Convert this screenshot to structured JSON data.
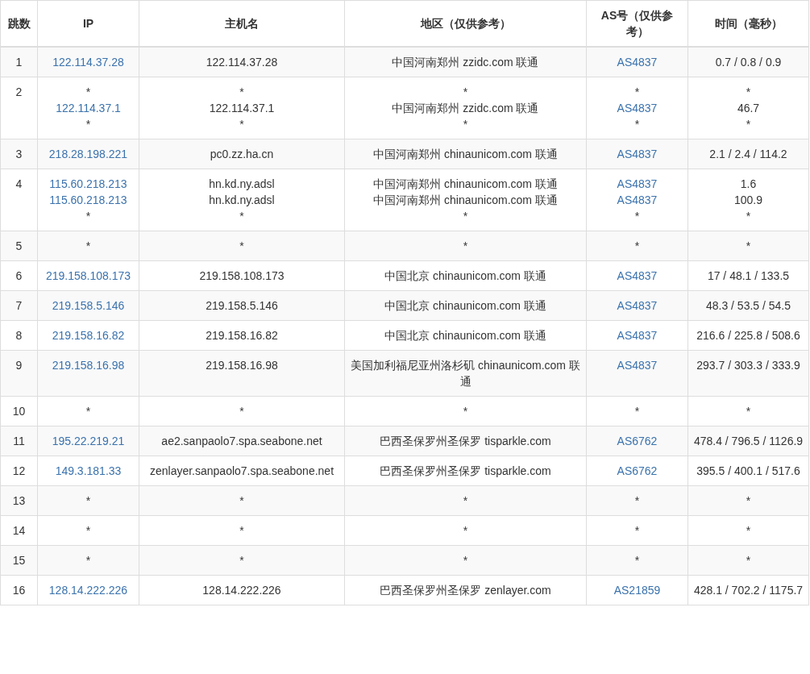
{
  "table": {
    "columns": [
      "跳数",
      "IP",
      "主机名",
      "地区（仅供参考）",
      "AS号（仅供参考）",
      "时间（毫秒）"
    ],
    "rows": [
      {
        "hop": "1",
        "ip": [
          {
            "text": "122.114.37.28",
            "kind": "link"
          }
        ],
        "host": [
          "122.114.37.28"
        ],
        "region": [
          "中国河南郑州 zzidc.com 联通"
        ],
        "as": [
          {
            "text": "AS4837",
            "kind": "link"
          }
        ],
        "time": [
          "0.7 / 0.8 / 0.9"
        ]
      },
      {
        "hop": "2",
        "ip": [
          {
            "text": "*",
            "kind": "none"
          },
          {
            "text": "122.114.37.1",
            "kind": "link"
          },
          {
            "text": "*",
            "kind": "none"
          }
        ],
        "host": [
          "*",
          "122.114.37.1",
          "*"
        ],
        "region": [
          "*",
          "中国河南郑州 zzidc.com 联通",
          "*"
        ],
        "as": [
          {
            "text": "*",
            "kind": "none"
          },
          {
            "text": "AS4837",
            "kind": "link"
          },
          {
            "text": "*",
            "kind": "none"
          }
        ],
        "time": [
          "*",
          "46.7",
          "*"
        ]
      },
      {
        "hop": "3",
        "ip": [
          {
            "text": "218.28.198.221",
            "kind": "link"
          }
        ],
        "host": [
          "pc0.zz.ha.cn"
        ],
        "region": [
          "中国河南郑州 chinaunicom.com 联通"
        ],
        "as": [
          {
            "text": "AS4837",
            "kind": "link"
          }
        ],
        "time": [
          "2.1 / 2.4 / 114.2"
        ]
      },
      {
        "hop": "4",
        "ip": [
          {
            "text": "115.60.218.213",
            "kind": "link"
          },
          {
            "text": "115.60.218.213",
            "kind": "link"
          },
          {
            "text": "*",
            "kind": "none"
          }
        ],
        "host": [
          "hn.kd.ny.adsl",
          "hn.kd.ny.adsl",
          "*"
        ],
        "region": [
          "中国河南郑州 chinaunicom.com 联通",
          "中国河南郑州 chinaunicom.com 联通",
          "*"
        ],
        "as": [
          {
            "text": "AS4837",
            "kind": "link"
          },
          {
            "text": "AS4837",
            "kind": "link"
          },
          {
            "text": "*",
            "kind": "none"
          }
        ],
        "time": [
          "1.6",
          "100.9",
          "*"
        ]
      },
      {
        "hop": "5",
        "ip": [
          {
            "text": "*",
            "kind": "none"
          }
        ],
        "host": [
          "*"
        ],
        "region": [
          "*"
        ],
        "as": [
          {
            "text": "*",
            "kind": "none"
          }
        ],
        "time": [
          "*"
        ]
      },
      {
        "hop": "6",
        "ip": [
          {
            "text": "219.158.108.173",
            "kind": "link"
          }
        ],
        "host": [
          "219.158.108.173"
        ],
        "region": [
          "中国北京 chinaunicom.com 联通"
        ],
        "as": [
          {
            "text": "AS4837",
            "kind": "link"
          }
        ],
        "time": [
          "17 / 48.1 / 133.5"
        ]
      },
      {
        "hop": "7",
        "ip": [
          {
            "text": "219.158.5.146",
            "kind": "link"
          }
        ],
        "host": [
          "219.158.5.146"
        ],
        "region": [
          "中国北京 chinaunicom.com 联通"
        ],
        "as": [
          {
            "text": "AS4837",
            "kind": "link"
          }
        ],
        "time": [
          "48.3 / 53.5 / 54.5"
        ]
      },
      {
        "hop": "8",
        "ip": [
          {
            "text": "219.158.16.82",
            "kind": "link"
          }
        ],
        "host": [
          "219.158.16.82"
        ],
        "region": [
          "中国北京 chinaunicom.com 联通"
        ],
        "as": [
          {
            "text": "AS4837",
            "kind": "link"
          }
        ],
        "time": [
          "216.6 / 225.8 / 508.6"
        ]
      },
      {
        "hop": "9",
        "ip": [
          {
            "text": "219.158.16.98",
            "kind": "link"
          }
        ],
        "host": [
          "219.158.16.98"
        ],
        "region": [
          "美国加利福尼亚州洛杉矶 chinaunicom.com 联通"
        ],
        "as": [
          {
            "text": "AS4837",
            "kind": "link"
          }
        ],
        "time": [
          "293.7 / 303.3 / 333.9"
        ]
      },
      {
        "hop": "10",
        "ip": [
          {
            "text": "*",
            "kind": "none"
          }
        ],
        "host": [
          "*"
        ],
        "region": [
          "*"
        ],
        "as": [
          {
            "text": "*",
            "kind": "none"
          }
        ],
        "time": [
          "*"
        ]
      },
      {
        "hop": "11",
        "ip": [
          {
            "text": "195.22.219.21",
            "kind": "link"
          }
        ],
        "host": [
          "ae2.sanpaolo7.spa.seabone.net"
        ],
        "region": [
          "巴西圣保罗州圣保罗 tisparkle.com"
        ],
        "as": [
          {
            "text": "AS6762",
            "kind": "link"
          }
        ],
        "time": [
          "478.4 / 796.5 / 1126.9"
        ]
      },
      {
        "hop": "12",
        "ip": [
          {
            "text": "149.3.181.33",
            "kind": "link"
          }
        ],
        "host": [
          "zenlayer.sanpaolo7.spa.seabone.net"
        ],
        "region": [
          "巴西圣保罗州圣保罗 tisparkle.com"
        ],
        "as": [
          {
            "text": "AS6762",
            "kind": "link"
          }
        ],
        "time": [
          "395.5 / 400.1 / 517.6"
        ]
      },
      {
        "hop": "13",
        "ip": [
          {
            "text": "*",
            "kind": "none"
          }
        ],
        "host": [
          "*"
        ],
        "region": [
          "*"
        ],
        "as": [
          {
            "text": "*",
            "kind": "none"
          }
        ],
        "time": [
          "*"
        ]
      },
      {
        "hop": "14",
        "ip": [
          {
            "text": "*",
            "kind": "none"
          }
        ],
        "host": [
          "*"
        ],
        "region": [
          "*"
        ],
        "as": [
          {
            "text": "*",
            "kind": "none"
          }
        ],
        "time": [
          "*"
        ]
      },
      {
        "hop": "15",
        "ip": [
          {
            "text": "*",
            "kind": "none"
          }
        ],
        "host": [
          "*"
        ],
        "region": [
          "*"
        ],
        "as": [
          {
            "text": "*",
            "kind": "none"
          }
        ],
        "time": [
          "*"
        ]
      },
      {
        "hop": "16",
        "ip": [
          {
            "text": "128.14.222.226",
            "kind": "link"
          }
        ],
        "host": [
          "128.14.222.226"
        ],
        "region": [
          "巴西圣保罗州圣保罗 zenlayer.com"
        ],
        "as": [
          {
            "text": "AS21859",
            "kind": "link"
          }
        ],
        "time": [
          "428.1 / 702.2 / 1175.7"
        ]
      }
    ]
  }
}
